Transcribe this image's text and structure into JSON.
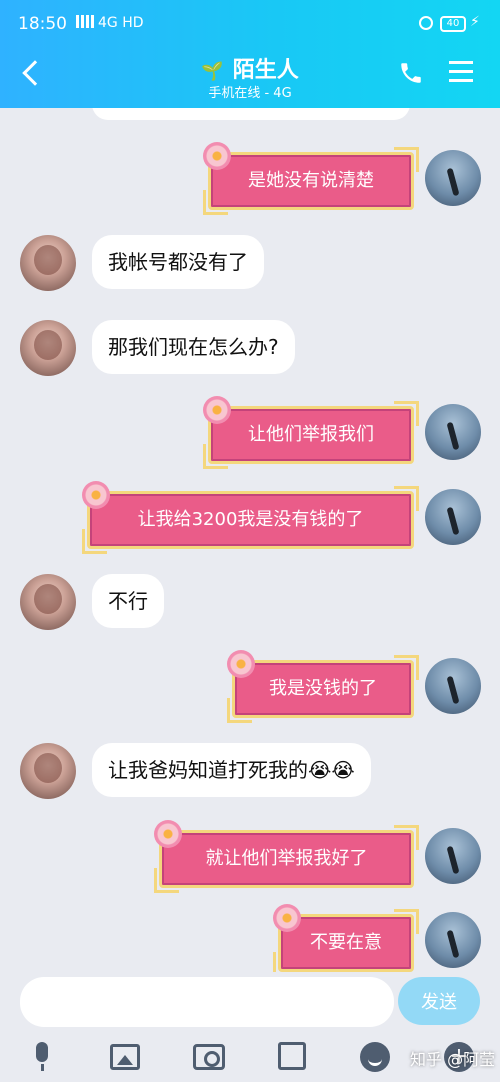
{
  "status": {
    "time": "18:50",
    "network": "4G",
    "hd": "HD",
    "battery": "40"
  },
  "header": {
    "title": "陌生人",
    "subtitle": "手机在线 - 4G"
  },
  "messages": [
    {
      "from": "me",
      "text": "是她没有说清楚"
    },
    {
      "from": "her",
      "text": "我帐号都没有了"
    },
    {
      "from": "her",
      "text": "那我们现在怎么办?"
    },
    {
      "from": "me",
      "text": "让他们举报我们"
    },
    {
      "from": "me",
      "text": "让我给3200我是没有钱的了"
    },
    {
      "from": "her",
      "text": "不行"
    },
    {
      "from": "me",
      "text": "我是没钱的了"
    },
    {
      "from": "her",
      "text": "让我爸妈知道打死我的😭😭"
    },
    {
      "from": "me",
      "text": "就让他们举报我好了"
    },
    {
      "from": "me",
      "text": "不要在意"
    }
  ],
  "input": {
    "value": "",
    "send_label": "发送"
  },
  "icons": [
    "back-icon",
    "phone-icon",
    "menu-icon",
    "mic-icon",
    "image-icon",
    "camera-icon",
    "gift-icon",
    "emoji-icon",
    "plus-icon"
  ],
  "watermark": "知乎 @阿莹"
}
